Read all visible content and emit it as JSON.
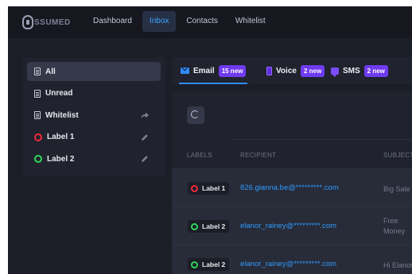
{
  "app": {
    "logo_text": "SSUMED"
  },
  "nav": {
    "items": [
      {
        "label": "Dashboard"
      },
      {
        "label": "Inbox"
      },
      {
        "label": "Contacts"
      },
      {
        "label": "Whitelist"
      }
    ],
    "active": "Inbox"
  },
  "sidebar": {
    "items": [
      {
        "label": "All",
        "icon": "document-icon",
        "active": true
      },
      {
        "label": "Unread",
        "icon": "document-icon"
      },
      {
        "label": "Whitelist",
        "icon": "document-icon",
        "action_icon": "share-icon"
      },
      {
        "label": "Label 1",
        "icon": "red-ring-icon",
        "action_icon": "pencil-icon"
      },
      {
        "label": "Label 2",
        "icon": "green-ring-icon",
        "action_icon": "pencil-icon"
      }
    ]
  },
  "tabs": [
    {
      "label": "Email",
      "badge": "15 new",
      "icon": "mail-icon",
      "active": true
    },
    {
      "label": "Voice",
      "badge": "2 new",
      "icon": "phone-icon"
    },
    {
      "label": "SMS",
      "badge": "2 new",
      "icon": "sms-icon"
    }
  ],
  "table": {
    "headers": {
      "labels": "LABELS",
      "recipient": "RECIPIENT",
      "subject": "SUBJECT"
    },
    "rows": [
      {
        "label": "Label 1",
        "label_color": "#ef2b3b",
        "recipient": "826.gianna.be@*********.com",
        "subject_1": "Big Sale",
        "subject_2": ""
      },
      {
        "label": "Label 2",
        "label_color": "#2ed65b",
        "recipient": "elanor_rainey@*********.com",
        "subject_1": "Free",
        "subject_2": "Money"
      },
      {
        "label": "Label 2",
        "label_color": "#2ed65b",
        "recipient": "elanor_rainey@*********.com",
        "subject_1": "Hi Elanor",
        "subject_2": ""
      }
    ]
  },
  "colors": {
    "accent": "#2f8cff",
    "badge": "#6f3bf0",
    "background": "#1b1d27"
  }
}
